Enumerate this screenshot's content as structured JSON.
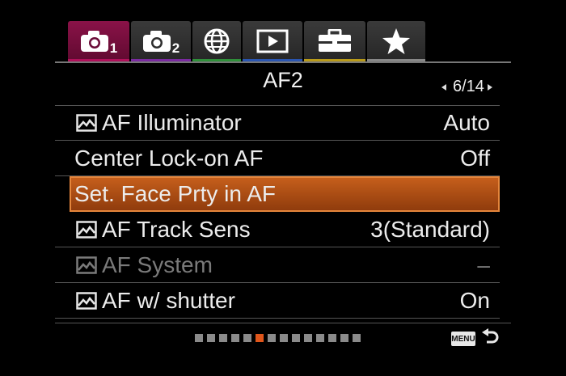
{
  "tabs": [
    {
      "icon": "camera-icon",
      "number": "1",
      "accent": "#b0105a",
      "active": true
    },
    {
      "icon": "camera-icon",
      "number": "2",
      "accent": "#7a2aa0",
      "active": false
    },
    {
      "icon": "globe-icon",
      "accent": "#2f8f3a",
      "active": false
    },
    {
      "icon": "playback-icon",
      "accent": "#2a55b0",
      "active": false
    },
    {
      "icon": "toolbox-icon",
      "accent": "#b89a1a",
      "active": false
    },
    {
      "icon": "star-icon",
      "accent": "#888888",
      "active": false
    }
  ],
  "header": {
    "title": "AF2",
    "page_indicator": "6/14"
  },
  "menu_items": [
    {
      "label": "AF Illuminator",
      "value": "Auto",
      "has_photo_icon": true,
      "state": "normal"
    },
    {
      "label": "Center Lock-on AF",
      "value": "Off",
      "has_photo_icon": false,
      "state": "normal"
    },
    {
      "label": "Set. Face Prty in AF",
      "value": "",
      "has_photo_icon": false,
      "state": "selected"
    },
    {
      "label": "AF Track Sens",
      "value": "3(Standard)",
      "has_photo_icon": true,
      "state": "normal"
    },
    {
      "label": "AF System",
      "value": "–",
      "has_photo_icon": true,
      "state": "disabled"
    },
    {
      "label": "AF w/ shutter",
      "value": "On",
      "has_photo_icon": true,
      "state": "normal"
    }
  ],
  "scroll": {
    "total": 14,
    "current": 6
  },
  "footer": {
    "menu_button_label": "MENU",
    "back_icon": "return-arrow-icon"
  },
  "colors": {
    "selection": "#c8601c",
    "current_dot": "#e0561b",
    "dot": "#8a8a8a"
  }
}
